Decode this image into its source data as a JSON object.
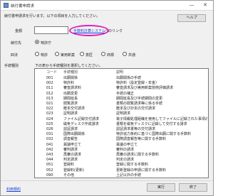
{
  "window": {
    "title": "納付書申請求"
  },
  "help_button": "ヘルプ",
  "instruction": "納付書申請求を行います。以下の項目を入力してください。",
  "amount": {
    "label": "金額",
    "value": "",
    "link": "手数料計算システム",
    "suffix": "へのリンク"
  },
  "payee": {
    "label": "納付先",
    "option": "特許庁"
  },
  "law": {
    "label": "四法",
    "options": [
      "特許",
      "実用新案",
      "意匠",
      "商標",
      "共通"
    ]
  },
  "fee_type": {
    "label": "手続種別",
    "hint": "下の表から手続種別を選択してください。"
  },
  "table": {
    "headers": [
      "コード",
      "手続種別",
      "説明"
    ],
    "rows": [
      [
        "001",
        "出願関係",
        "出願関係の手続"
      ],
      [
        "002",
        "特許料",
        "特許料（設定登録・年金）"
      ],
      [
        "011",
        "審査請求料",
        "審査請求及び実用新案技術評価請求"
      ],
      [
        "012",
        "出願変更",
        "手続の補正"
      ],
      [
        "013",
        "期間延長",
        "期間延長及び手続期間の変更"
      ],
      [
        "021",
        "閲覧請求",
        "書類の閲覧請求等に係る手続"
      ],
      [
        "022",
        "謄本交付請求",
        "謄本及び抄本の交付請求"
      ],
      [
        "023",
        "証明請求",
        "証明請求"
      ],
      [
        "024",
        "ファイル記録交付請求",
        "電子情報処理組織を使用してファイルに記録された事項の交付請求"
      ],
      [
        "025",
        "磁気ディスク作成請求",
        "書類を磁気ディスクに記録して交付する請求"
      ],
      [
        "026",
        "認証請求",
        "認証請求書等の交付請求"
      ],
      [
        "031",
        "国際出願関係",
        "特許協力条約に基づく国際出願に関する手数料"
      ],
      [
        "032",
        "調査報告",
        "国際調査報告等に関する手数料"
      ],
      [
        "041",
        "異議申立て",
        "異議の申立て"
      ],
      [
        "042",
        "審判請求",
        "審判の請求"
      ],
      [
        "043",
        "再審の請求",
        "再審の請求に関する手数料"
      ],
      [
        "044",
        "判定請求",
        "判定の請求"
      ],
      [
        "051",
        "登録料",
        "登録に関する手数料"
      ],
      [
        "052",
        "登録料(更新)",
        "更新登録の申請に関する手数料"
      ],
      [
        "090",
        "その他",
        "上記以外の手続"
      ]
    ]
  },
  "footer": {
    "help_link": "利用規約",
    "execute_button": "実行",
    "close_button": "終了"
  }
}
